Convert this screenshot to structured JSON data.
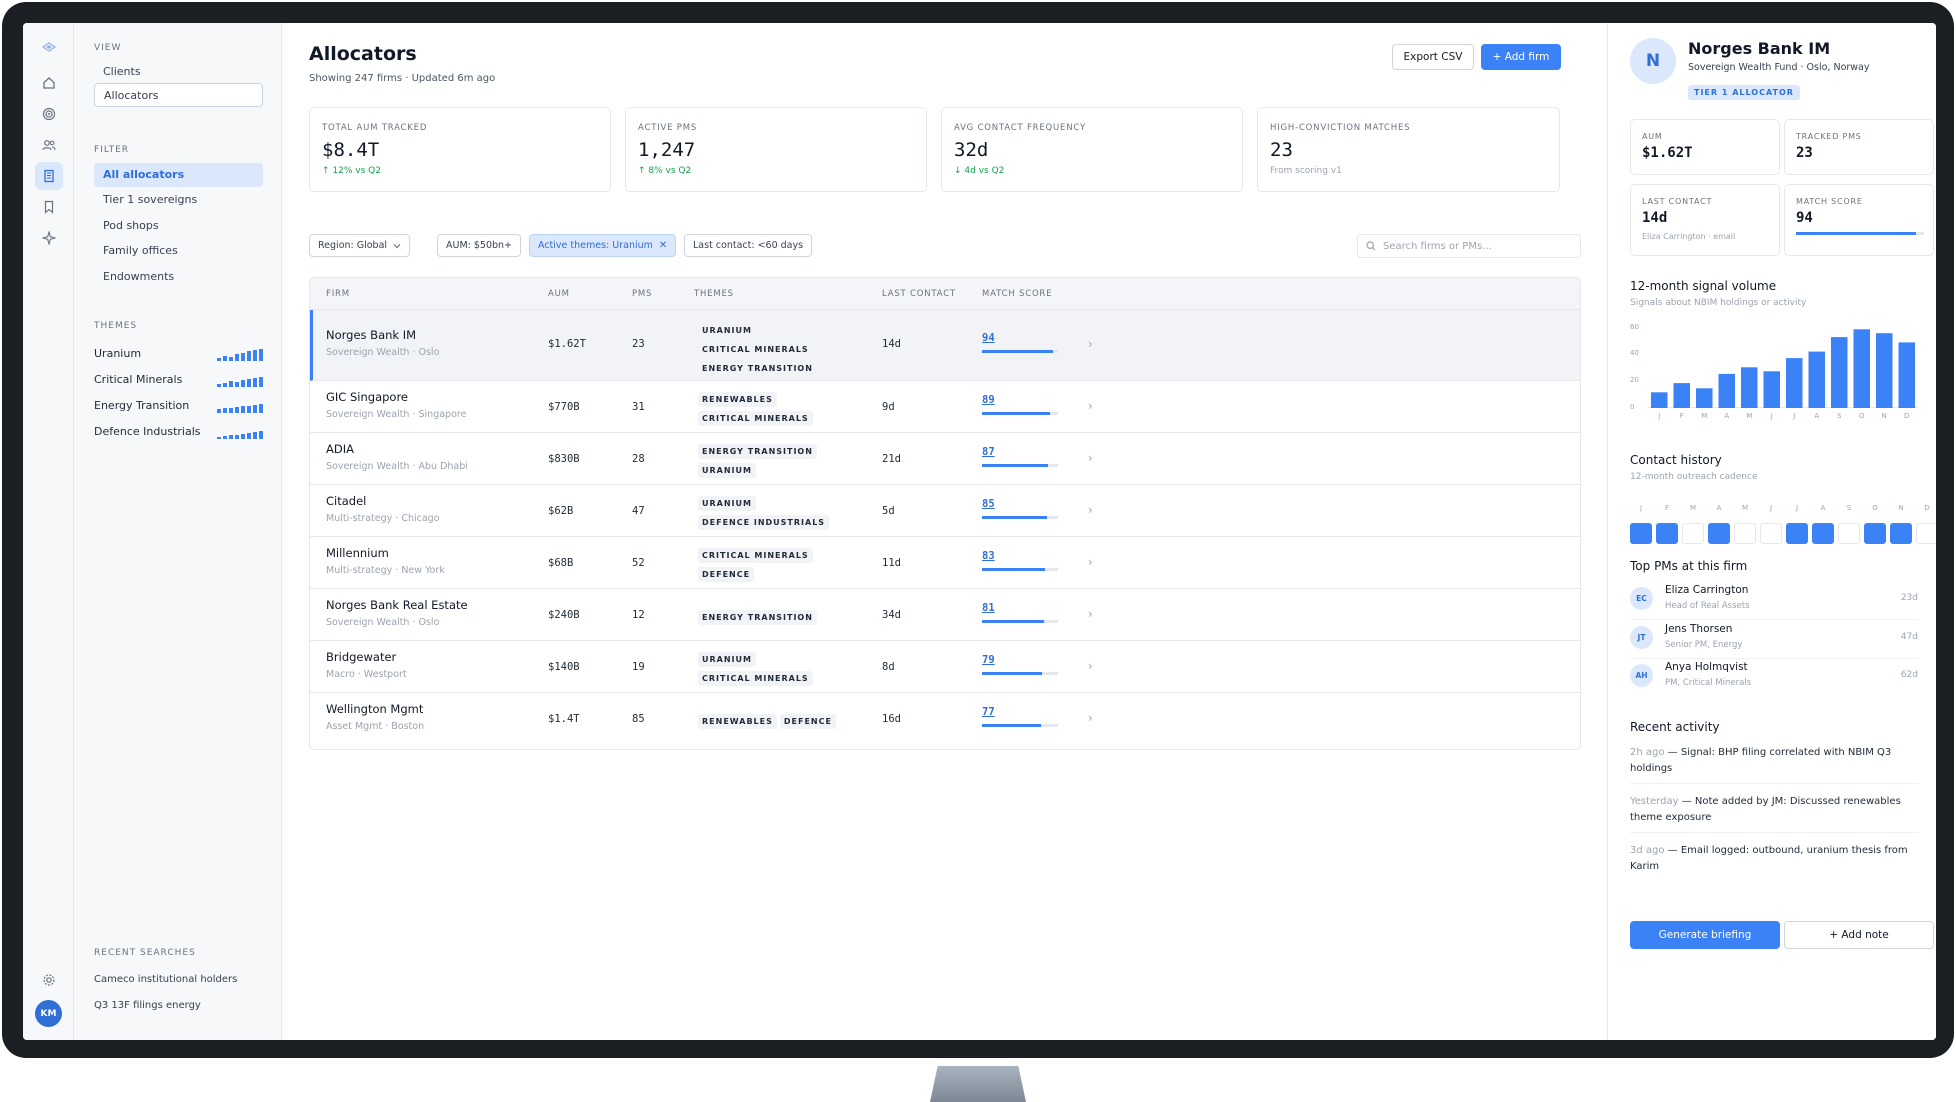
{
  "rail": {
    "avatar_initials": "KM"
  },
  "sidebar": {
    "view_title": "VIEW",
    "view_items": [
      "Clients",
      "Allocators"
    ],
    "filter_title": "FILTER",
    "filter_items": [
      "All allocators",
      "Tier 1 sovereigns",
      "Pod shops",
      "Family offices",
      "Endowments"
    ],
    "themes_title": "THEMES",
    "themes": [
      "Uranium",
      "Critical Minerals",
      "Energy Transition",
      "Defence Industrials"
    ],
    "recent_title": "RECENT SEARCHES",
    "recent": [
      "Cameco institutional holders",
      "Q3 13F filings energy"
    ]
  },
  "header": {
    "title": "Allocators",
    "subtitle": "Showing 247 firms · Updated 6m ago",
    "export_label": "Export CSV",
    "add_label": "+ Add firm"
  },
  "stats": [
    {
      "label": "TOTAL AUM TRACKED",
      "value": "$8.4T",
      "sub": "↑ 12% vs Q2"
    },
    {
      "label": "ACTIVE PMS",
      "value": "1,247",
      "sub": "↑ 8% vs Q2"
    },
    {
      "label": "AVG CONTACT FREQUENCY",
      "value": "32d",
      "sub": "↓ 4d vs Q2"
    },
    {
      "label": "HIGH-CONVICTION MATCHES",
      "value": "23",
      "sub": "From scoring v1"
    }
  ],
  "filters": {
    "region": "Region: Global",
    "aum": "AUM: $50bn+",
    "themes": "Active themes: Uranium",
    "contact": "Last contact: <60 days",
    "search_placeholder": "Search firms or PMs..."
  },
  "table": {
    "columns": [
      "FIRM",
      "AUM",
      "PMS",
      "THEMES",
      "LAST CONTACT",
      "MATCH SCORE"
    ],
    "rows": [
      {
        "firm": "Norges Bank IM",
        "sub": "Sovereign Wealth · Oslo",
        "aum": "$1.62T",
        "pms": "23",
        "themes": [
          "URANIUM",
          "CRITICAL MINERALS",
          "ENERGY TRANSITION"
        ],
        "last_contact": "14d",
        "score": "94"
      },
      {
        "firm": "GIC Singapore",
        "sub": "Sovereign Wealth · Singapore",
        "aum": "$770B",
        "pms": "31",
        "themes": [
          "RENEWABLES",
          "CRITICAL MINERALS"
        ],
        "last_contact": "9d",
        "score": "89"
      },
      {
        "firm": "ADIA",
        "sub": "Sovereign Wealth · Abu Dhabi",
        "aum": "$830B",
        "pms": "28",
        "themes": [
          "ENERGY TRANSITION",
          "URANIUM"
        ],
        "last_contact": "21d",
        "score": "87"
      },
      {
        "firm": "Citadel",
        "sub": "Multi-strategy · Chicago",
        "aum": "$62B",
        "pms": "47",
        "themes": [
          "URANIUM",
          "DEFENCE INDUSTRIALS"
        ],
        "last_contact": "5d",
        "score": "85"
      },
      {
        "firm": "Millennium",
        "sub": "Multi-strategy · New York",
        "aum": "$68B",
        "pms": "52",
        "themes": [
          "CRITICAL MINERALS",
          "DEFENCE"
        ],
        "last_contact": "11d",
        "score": "83"
      },
      {
        "firm": "Norges Bank Real Estate",
        "sub": "Sovereign Wealth · Oslo",
        "aum": "$240B",
        "pms": "12",
        "themes": [
          "ENERGY TRANSITION"
        ],
        "last_contact": "34d",
        "score": "81"
      },
      {
        "firm": "Bridgewater",
        "sub": "Macro · Westport",
        "aum": "$140B",
        "pms": "19",
        "themes": [
          "URANIUM",
          "CRITICAL MINERALS"
        ],
        "last_contact": "8d",
        "score": "79"
      },
      {
        "firm": "Wellington Mgmt",
        "sub": "Asset Mgmt · Boston",
        "aum": "$1.4T",
        "pms": "85",
        "themes": [
          "RENEWABLES",
          "DEFENCE"
        ],
        "last_contact": "16d",
        "score": "77"
      }
    ]
  },
  "panel": {
    "initial": "N",
    "name": "Norges Bank IM",
    "sub": "Sovereign Wealth Fund · Oslo, Norway",
    "tier": "TIER 1 ALLOCATOR",
    "kpis": {
      "aum_label": "AUM",
      "aum_value": "$1.62T",
      "pms_label": "TRACKED PMS",
      "pms_value": "23",
      "contact_label": "LAST CONTACT",
      "contact_value": "14d",
      "contact_sub": "Eliza Carrington · email",
      "score_label": "MATCH SCORE",
      "score_value": "94"
    },
    "signal_title": "12-month signal volume",
    "signal_sub": "Signals about NBIM holdings or activity",
    "history_title": "Contact history",
    "history_sub": "12-month outreach cadence",
    "months": [
      "J",
      "F",
      "M",
      "A",
      "M",
      "J",
      "J",
      "A",
      "S",
      "O",
      "N",
      "D"
    ],
    "contact_months": [
      1,
      1,
      0,
      1,
      0,
      0,
      1,
      1,
      0,
      1,
      1,
      0
    ],
    "pms_title": "Top PMs at this firm",
    "pms": [
      {
        "initials": "EC",
        "name": "Eliza Carrington",
        "role": "Head of Real Assets",
        "days": "23d"
      },
      {
        "initials": "JT",
        "name": "Jens Thorsen",
        "role": "Senior PM, Energy",
        "days": "47d"
      },
      {
        "initials": "AH",
        "name": "Anya Holmqvist",
        "role": "PM, Critical Minerals",
        "days": "62d"
      }
    ],
    "activity_title": "Recent activity",
    "activity": [
      {
        "time": "2h ago",
        "text": " — Signal: BHP filing correlated with NBIM Q3 holdings"
      },
      {
        "time": "Yesterday",
        "text": " — Note added by JM: Discussed renewables theme exposure"
      },
      {
        "time": "3d ago",
        "text": " — Email logged: outbound, uranium thesis from Karim"
      }
    ],
    "generate_label": "Generate briefing",
    "note_label": "+ Add note"
  },
  "chart_data": {
    "type": "bar",
    "title": "12-month signal volume",
    "categories": [
      "J",
      "F",
      "M",
      "A",
      "M",
      "J",
      "J",
      "A",
      "S",
      "O",
      "N",
      "D"
    ],
    "values": [
      12,
      19,
      15,
      26,
      31,
      28,
      38,
      43,
      54,
      60,
      57,
      50
    ],
    "ylim": [
      0,
      60
    ],
    "yticks": [
      0,
      20,
      40,
      60
    ],
    "color": "#3b82f6"
  },
  "colors": {
    "accent": "#3b82f6",
    "accent_text": "#2f6fd6",
    "positive": "#16a34a"
  }
}
